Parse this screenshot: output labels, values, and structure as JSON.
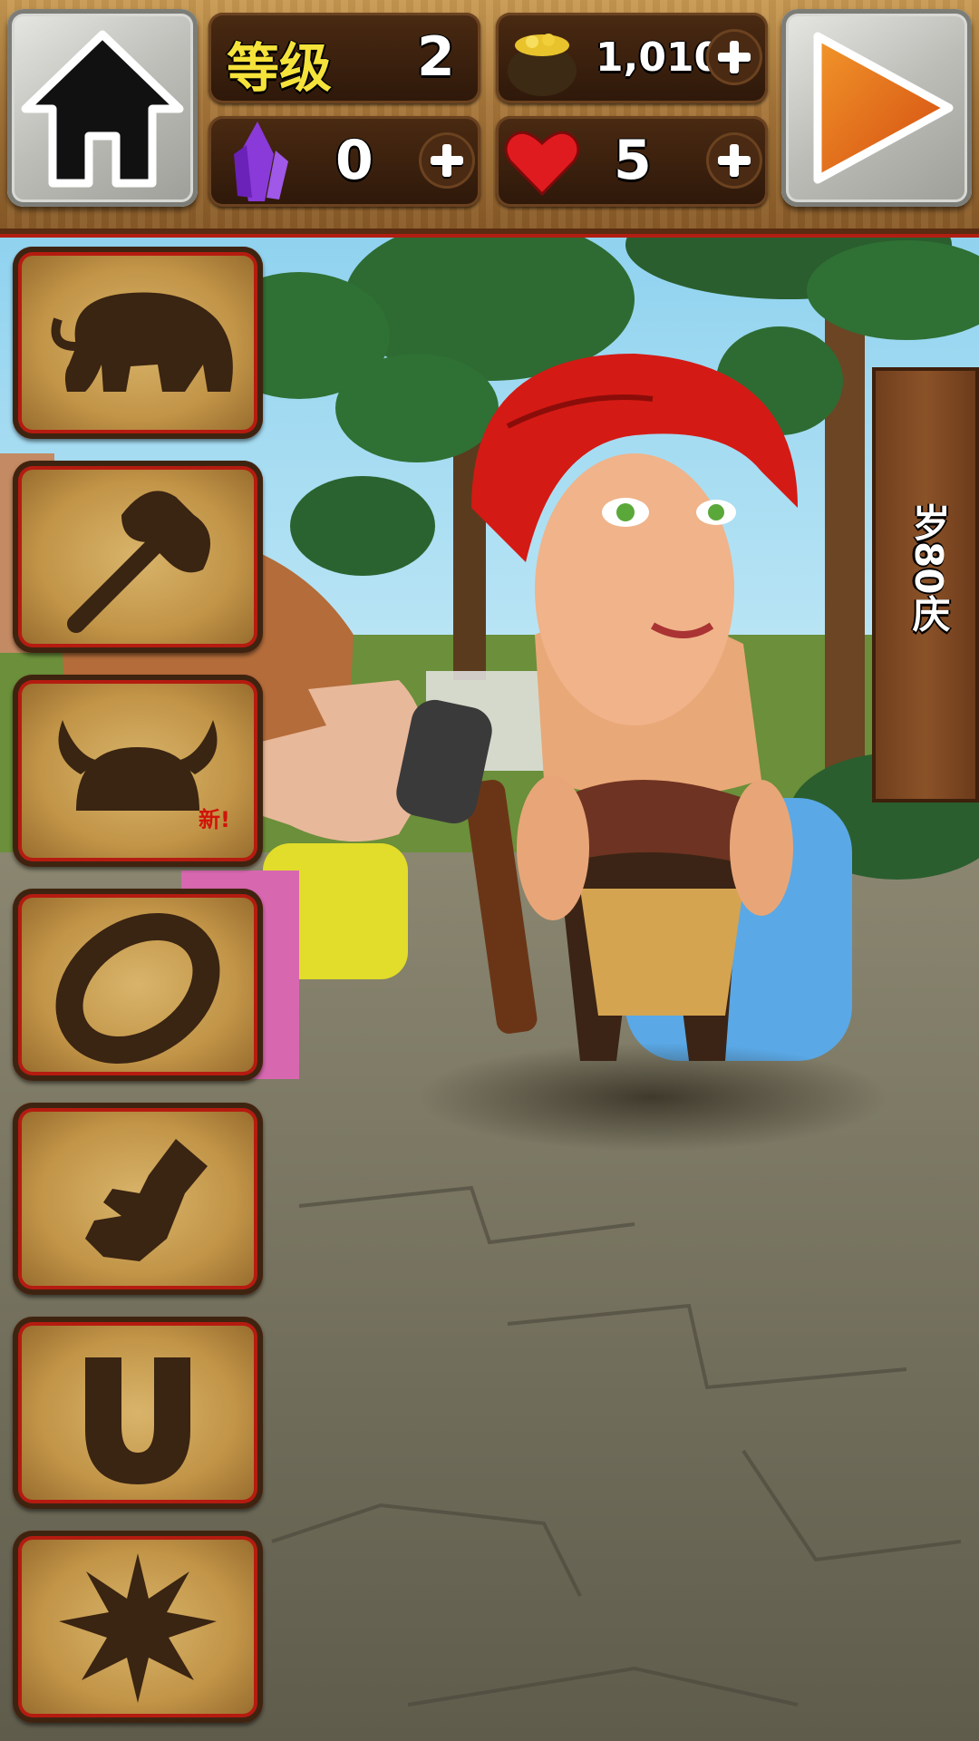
{
  "topbar": {
    "level_label": "等级",
    "level_value": "2",
    "gold_value": "1,010",
    "gems_value": "0",
    "lives_value": "5",
    "buttons": {
      "home": "home-icon",
      "play": "play-icon"
    }
  },
  "sidebar": {
    "slots": [
      {
        "icon": "mammoth-icon"
      },
      {
        "icon": "battle-axe-icon"
      },
      {
        "icon": "horned-helmet-icon"
      },
      {
        "icon": "ring-icon"
      },
      {
        "icon": "glove-icon"
      },
      {
        "icon": "horseshoe-icon"
      },
      {
        "icon": "spiky-burst-icon"
      }
    ],
    "new_badge": "新!"
  },
  "scene": {
    "sign_text": "岁80庆"
  },
  "colors": {
    "accent_red": "#b51b10",
    "level_label_yellow": "#f5e23a",
    "panel_wood": "#c29548"
  }
}
